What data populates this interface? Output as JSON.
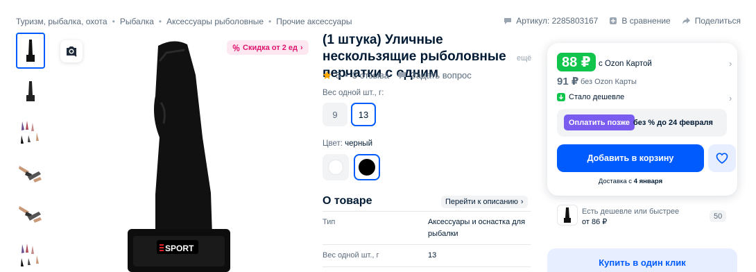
{
  "breadcrumbs": [
    "Туризм, рыбалка, охота",
    "Рыбалка",
    "Аксессуары рыболовные",
    "Прочие аксессуары"
  ],
  "header": {
    "article": "Артикул: 2285803167",
    "compare": "В сравнение",
    "share": "Поделиться"
  },
  "gallery": {
    "promo": "Скидка от 2 ед",
    "brand_print": "SPORT"
  },
  "product": {
    "title": "(1 штука) Уличные нескользящие рыболовные перчатки с одним",
    "title_more": "ещё",
    "rating": "5",
    "reviews": "3 отзыва",
    "ask": "Задать вопрос",
    "weight_label": "Вес одной шт., г:",
    "weight_options": [
      "9",
      "13"
    ],
    "color_label": "Цвет:",
    "color_value": "черный",
    "about_title": "О товаре",
    "to_description": "Перейти к описанию",
    "specs": [
      {
        "key": "Тип",
        "value": "Аксессуары и оснастка для рыбалки"
      },
      {
        "key": "Вес одной шт., г",
        "value": "13"
      }
    ]
  },
  "price": {
    "card_price": "88 ₽",
    "card_label": "с Ozon Картой",
    "regular_price": "91 ₽",
    "regular_label": "без Ozon Карты",
    "cheaper": "Стало дешевле",
    "pay_later_button": "Оплатить позже",
    "pay_later_text": "без % до 24 февраля",
    "add_to_cart": "Добавить в корзину",
    "delivery_prefix": "Доставка с",
    "delivery_date": "4 января"
  },
  "alt_offer": {
    "label": "Есть дешевле или быстрее",
    "price": "от 86 ₽",
    "count": "50"
  },
  "buy_one_click": "Купить в один клик",
  "colors": {
    "accent": "#005bff",
    "price_green": "#10c44c",
    "pay_later": "#7b5cf0",
    "promo": "#e0136d"
  }
}
